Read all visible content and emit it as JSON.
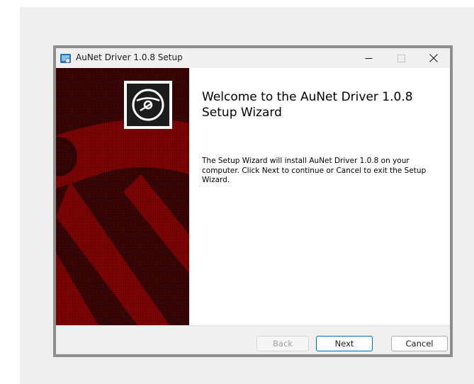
{
  "window": {
    "title": "AuNet Driver 1.0.8 Setup"
  },
  "content": {
    "heading": "Welcome to the AuNet Driver 1.0.8 Setup Wizard",
    "description": "The Setup Wizard will install AuNet Driver 1.0.8 on your computer. Click Next to continue or Cancel to exit the Setup Wizard."
  },
  "buttons": {
    "back": "Back",
    "next": "Next",
    "cancel": "Cancel"
  },
  "icons": {
    "app": "installer-app-icon",
    "banner": "disc-icon",
    "minimize": "minimize-icon",
    "maximize": "maximize-icon",
    "close": "close-icon"
  },
  "colors": {
    "banner_dark": "#3a0505",
    "banner_red": "#7d0000",
    "accent": "#0067c0"
  }
}
